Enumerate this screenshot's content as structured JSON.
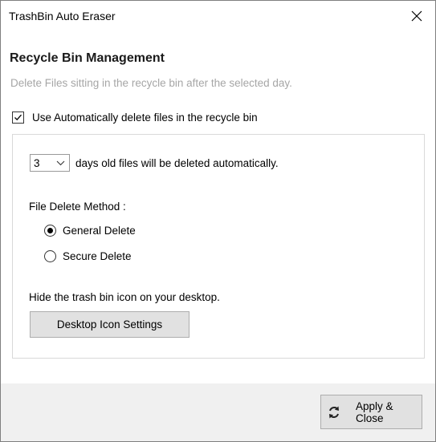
{
  "window": {
    "title": "TrashBin Auto Eraser"
  },
  "header": {
    "heading": "Recycle Bin Management",
    "subheading": "Delete Files sitting in the recycle bin after the selected day."
  },
  "auto_delete": {
    "label": "Use Automatically delete files in the recycle bin",
    "checked": true
  },
  "days": {
    "selected": "3",
    "label": "days old files will be deleted automatically."
  },
  "delete_method": {
    "label": "File Delete Method :",
    "options": [
      {
        "label": "General Delete",
        "checked": true
      },
      {
        "label": "Secure Delete",
        "checked": false
      }
    ]
  },
  "desktop_icon": {
    "label": "Hide the trash bin icon on your desktop.",
    "button_label": "Desktop Icon Settings"
  },
  "footer": {
    "apply_label": "Apply & Close",
    "apply_icon": "refresh-icon"
  }
}
